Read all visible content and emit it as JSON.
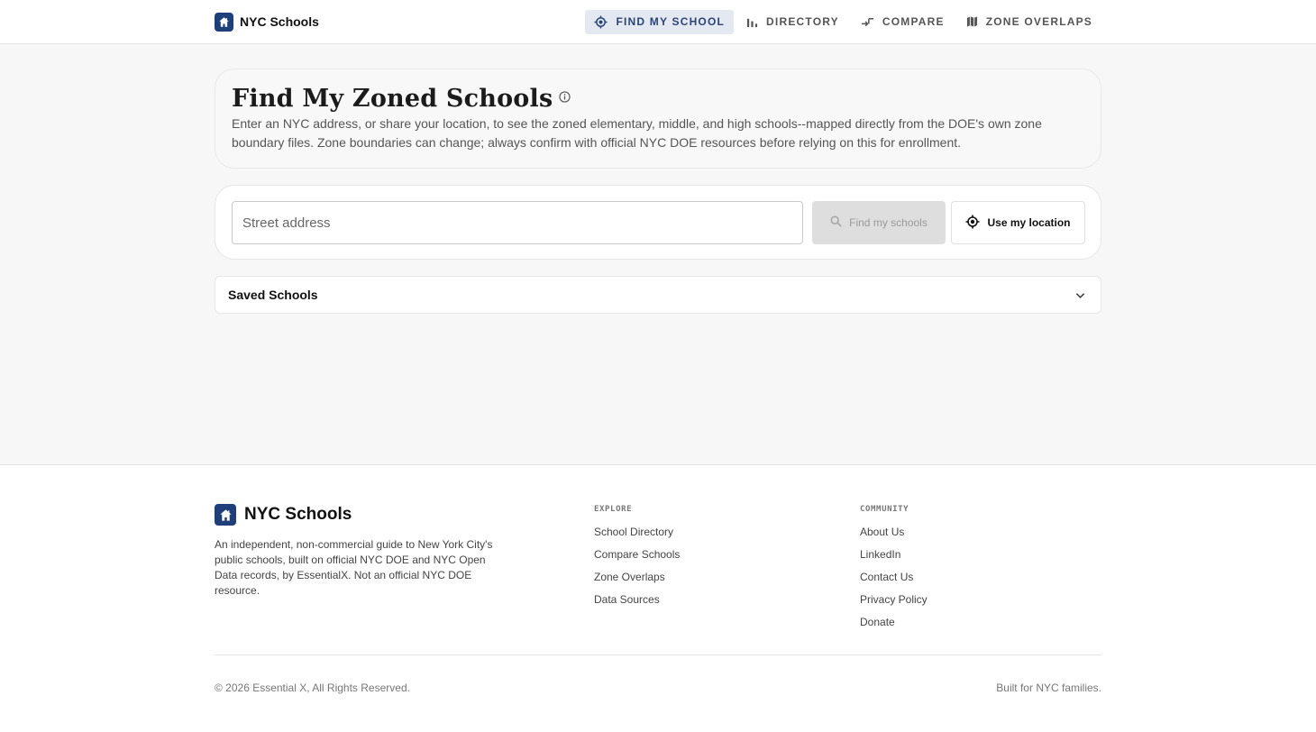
{
  "header": {
    "brand": "NYC Schools",
    "nav": [
      {
        "label": "FIND MY SCHOOL",
        "icon": "locate-icon",
        "active": true
      },
      {
        "label": "DIRECTORY",
        "icon": "bar-chart-icon",
        "active": false
      },
      {
        "label": "COMPARE",
        "icon": "compare-arrows-icon",
        "active": false
      },
      {
        "label": "ZONE OVERLAPS",
        "icon": "map-icon",
        "active": false
      }
    ]
  },
  "hero": {
    "title": "Find My Zoned Schools",
    "description": "Enter an NYC address, or share your location, to see the zoned elementary, middle, and high schools--mapped directly from the DOE's own zone boundary files. Zone boundaries can change; always confirm with official NYC DOE resources before relying on this for enrollment."
  },
  "search": {
    "placeholder": "Street address",
    "value": "",
    "find_label": "Find my schools",
    "location_label": "Use my location"
  },
  "saved": {
    "label": "Saved Schools"
  },
  "footer": {
    "brand": "NYC Schools",
    "about": "An independent, non-commercial guide to New York City's public schools, built on official NYC DOE and NYC Open Data records, by EssentialX. Not an official NYC DOE resource.",
    "explore": {
      "heading": "EXPLORE",
      "links": [
        "School Directory",
        "Compare Schools",
        "Zone Overlaps",
        "Data Sources"
      ]
    },
    "community": {
      "heading": "COMMUNITY",
      "links": [
        "About Us",
        "LinkedIn",
        "Contact Us",
        "Privacy Policy",
        "Donate"
      ]
    },
    "copyright": "© 2026 Essential X, All Rights Reserved.",
    "tagline": "Built for NYC families."
  },
  "colors": {
    "brand": "#1f3f7a",
    "nav_active_bg": "#e4e9f1",
    "nav_active_text": "#2a4477"
  }
}
